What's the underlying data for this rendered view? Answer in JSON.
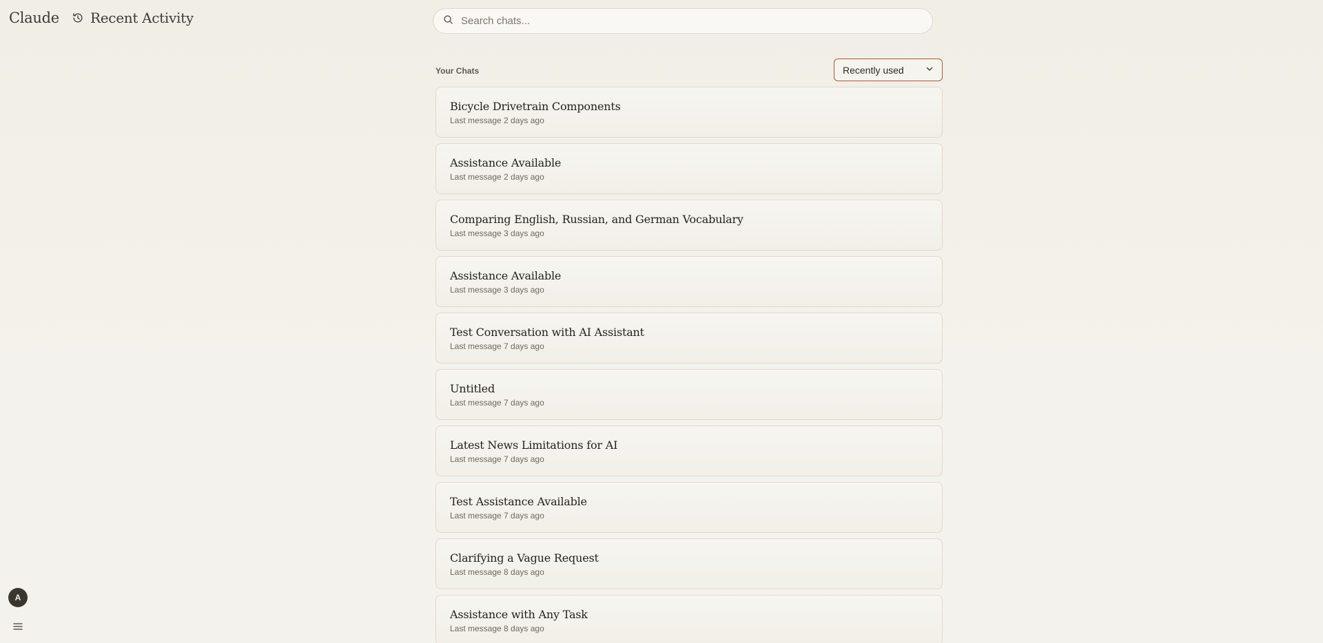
{
  "header": {
    "brand": "Claude",
    "recent_activity_label": "Recent Activity"
  },
  "search": {
    "placeholder": "Search chats...",
    "value": ""
  },
  "section": {
    "title": "Your Chats",
    "sort_label": "Recently used"
  },
  "chats": [
    {
      "title": "Bicycle Drivetrain Components",
      "meta": "Last message 2 days ago"
    },
    {
      "title": "Assistance Available",
      "meta": "Last message 2 days ago"
    },
    {
      "title": "Comparing English, Russian, and German Vocabulary",
      "meta": "Last message 3 days ago"
    },
    {
      "title": "Assistance Available",
      "meta": "Last message 3 days ago"
    },
    {
      "title": "Test Conversation with AI Assistant",
      "meta": "Last message 7 days ago"
    },
    {
      "title": "Untitled",
      "meta": "Last message 7 days ago"
    },
    {
      "title": "Latest News Limitations for AI",
      "meta": "Last message 7 days ago"
    },
    {
      "title": "Test Assistance Available",
      "meta": "Last message 7 days ago"
    },
    {
      "title": "Clarifying a Vague Request",
      "meta": "Last message 8 days ago"
    },
    {
      "title": "Assistance with Any Task",
      "meta": "Last message 8 days ago"
    }
  ],
  "user": {
    "avatar_initial": "A"
  },
  "icons": {
    "history": "history-icon",
    "search": "search-icon",
    "chevron": "chevron-down-icon",
    "menu": "menu-icon"
  },
  "colors": {
    "accent_border": "#b4533a",
    "background": "#f3f1eb",
    "avatar_bg": "#3a3730"
  }
}
